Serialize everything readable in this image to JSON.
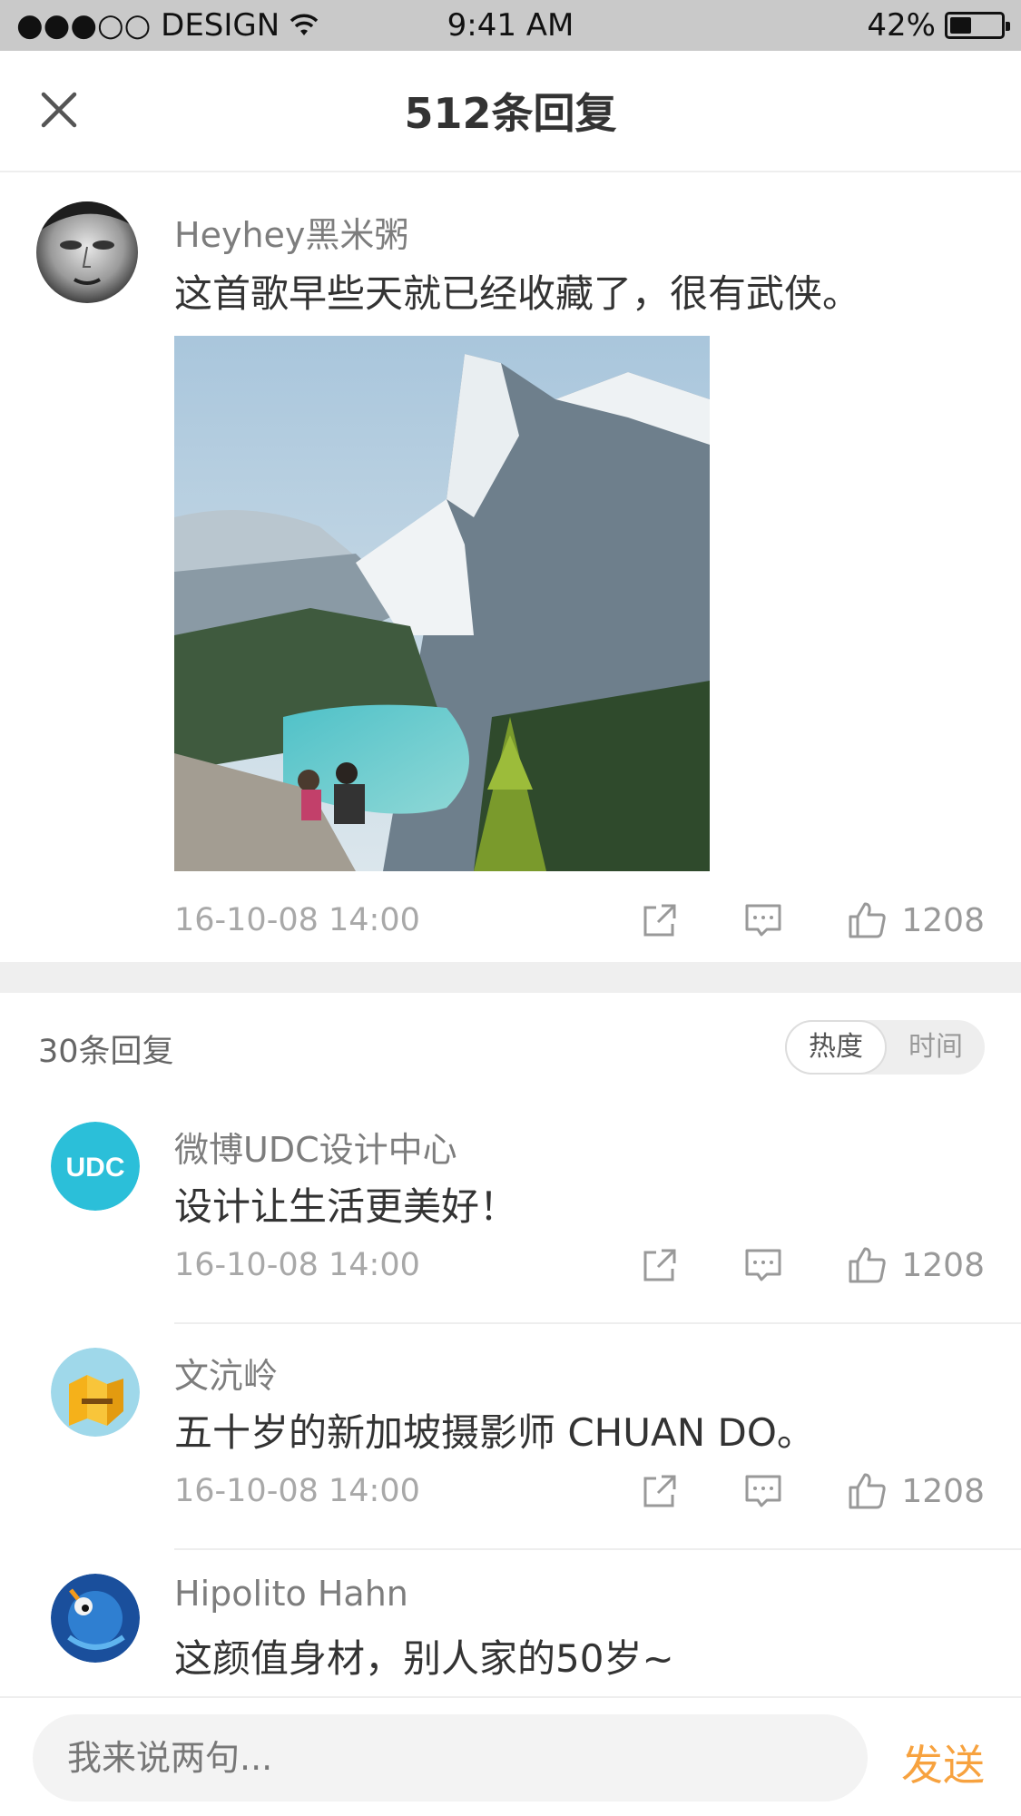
{
  "status_bar": {
    "carrier": "●●●○○ DESIGN",
    "time": "9:41 AM",
    "battery": "42%",
    "battery_level": 0.42
  },
  "header": {
    "title": "512条回复"
  },
  "main_comment": {
    "username": "Heyhey黑米粥",
    "text": "这首歌早些天就已经收藏了，很有武侠。",
    "time": "16-10-08 14:00",
    "likes": "1208"
  },
  "replies": {
    "count_label": "30条回复",
    "sort": {
      "hot": "热度",
      "time": "时间",
      "selected": "hot"
    },
    "items": [
      {
        "username": "微博UDC设计中心",
        "text": "设计让生活更美好！",
        "time": "16-10-08 14:00",
        "likes": "1208",
        "avatar_label": "UDC"
      },
      {
        "username": "文沆岭",
        "text": "五十岁的新加坡摄影师 CHUAN DO。",
        "time": "16-10-08 14:00",
        "likes": "1208"
      },
      {
        "username": "Hipolito Hahn",
        "text": "这颜值身材，别人家的50岁~"
      }
    ]
  },
  "input_bar": {
    "placeholder": "我来说两句...",
    "send_label": "发送"
  },
  "colors": {
    "accent": "#f7a23f",
    "udc_avatar": "#2bbfd9",
    "divider": "#eeeeee"
  }
}
